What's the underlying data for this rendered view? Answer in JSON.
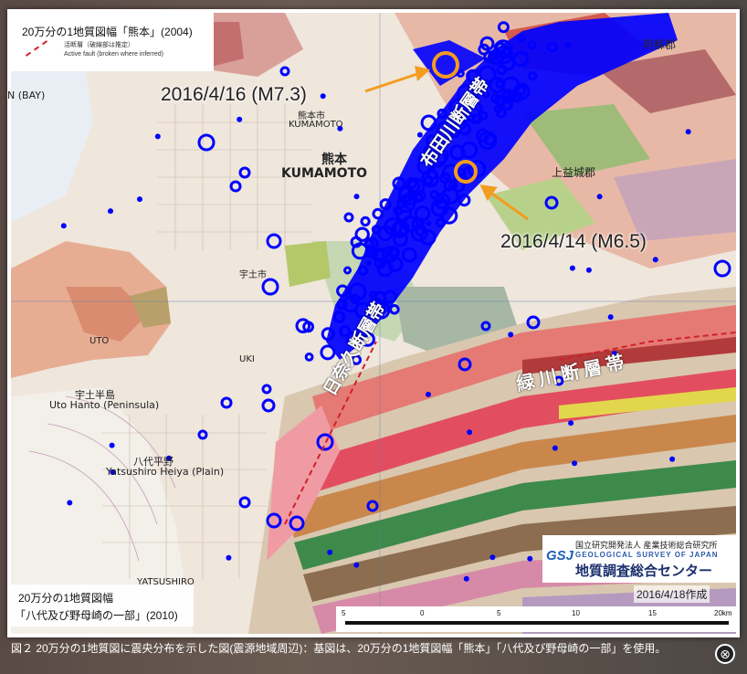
{
  "map": {
    "top_legend": {
      "title": "20万分の1地質図幅「熊本」(2004)",
      "fault_jp": "活断層（破線部は推定）",
      "fault_en": "Active fault (broken where inferred)"
    },
    "events": [
      {
        "label": "2016/4/16 (M7.3)",
        "color": "#f39c1f"
      },
      {
        "label": "2016/4/14 (M6.5)",
        "color": "#f39c1f"
      }
    ],
    "fault_zones": {
      "futagawa": "布田川断層帯",
      "hinagu": "日奈久断層帯",
      "midorikawa": "緑川断層帯"
    },
    "places": {
      "kumamoto_jp": "熊本",
      "kumamoto_en": "KUMAMOTO",
      "kumamoto_city": "熊本市",
      "uto": "宇土市",
      "uto_en": "UTO",
      "uki": "UKI",
      "uto_peninsula_jp": "宇土半島",
      "uto_peninsula_en": "Uto Hanto (Peninsula)",
      "yatsushiro_plain_jp": "八代平野",
      "yatsushiro_plain_en": "Yatsushiro Heiya (Plain)",
      "aso": "阿蘇郡",
      "kamimashiki": "上益城郡",
      "bay": "N (BAY)",
      "yatsushiro": "YATSUSHIRO"
    },
    "bottom_legend": {
      "line1": "20万分の1地質図幅",
      "line2": "「八代及び野母崎の一部」(2010)"
    },
    "date_note": "2016/4/18作成",
    "scale": {
      "labels": [
        "5",
        "0",
        "5",
        "10",
        "15",
        "20km"
      ]
    },
    "logo": {
      "org_jp": "国立研究開発法人 産業技術総合研究所",
      "org_en": "GEOLOGICAL SURVEY OF JAPAN",
      "center_jp": "地質調査総合センター",
      "mark": "GSJ"
    },
    "colors": {
      "epicenter": "#0000ff",
      "main_shock": "#f39c1f"
    }
  },
  "caption": "図２ 20万分の1地質図に震央分布を示した図(震源地域周辺)：基図は、20万分の1地質図幅「熊本」「八代及び野母崎の一部」を使用。",
  "close_label": "⊗"
}
